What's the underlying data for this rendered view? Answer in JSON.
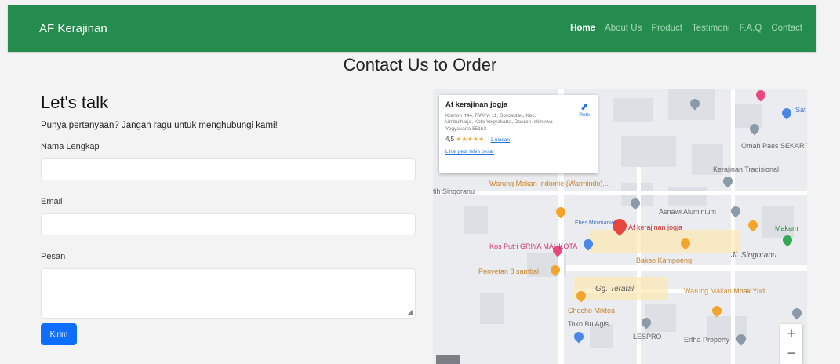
{
  "navbar": {
    "brand": "AF Kerajinan",
    "links": [
      "Home",
      "About Us",
      "Product",
      "Testimoni",
      "F.A.Q",
      "Contact"
    ],
    "active": "Home",
    "color": "#248c4d"
  },
  "section_title": "Contact Us to Order",
  "form": {
    "heading": "Let's talk",
    "subheading": "Punya pertanyaan? Jangan ragu untuk menghubungi kami!",
    "name_label": "Nama Lengkap",
    "email_label": "Email",
    "message_label": "Pesan",
    "submit_label": "Kirim",
    "button_color": "#0d6efd"
  },
  "map": {
    "card": {
      "name": "Af kerajinan jogja",
      "address": "Kranon rt44, RW/rw 11, Sorosutan, Kec. Umbulharjo, Kota Yogyakarta, Daerah Istimewa Yogyakarta 55162",
      "rating": "4,5",
      "stars": "★★★★★",
      "reviews": "3 ulasan",
      "larger_map": "Lihat peta lebih besar",
      "route": "Rute"
    },
    "labels": [
      "Sat Kor",
      "Omah Paes SEKAR TANJUNG, Bu.Nur",
      "Kerajinan Tradisional",
      "Warung Makan Indomie (Warmindo)...",
      "tih Singoranu",
      "Asnawi Aluminium",
      "Makam",
      "Ebes Minimarket",
      "Af kerajinan jogja",
      "Kos Putri GRIYA MAHKOTA",
      "Bakso Kampoeng",
      "Jl. Singoranu",
      "Penyetan 8 sambal",
      "Gg. Teratai",
      "Warung Makan Mbak Yud",
      "Chocho Miktea",
      "Toko Bu Agis",
      "LESPRO",
      "Ertha Property"
    ],
    "zoom_in": "+",
    "zoom_out": "−"
  }
}
